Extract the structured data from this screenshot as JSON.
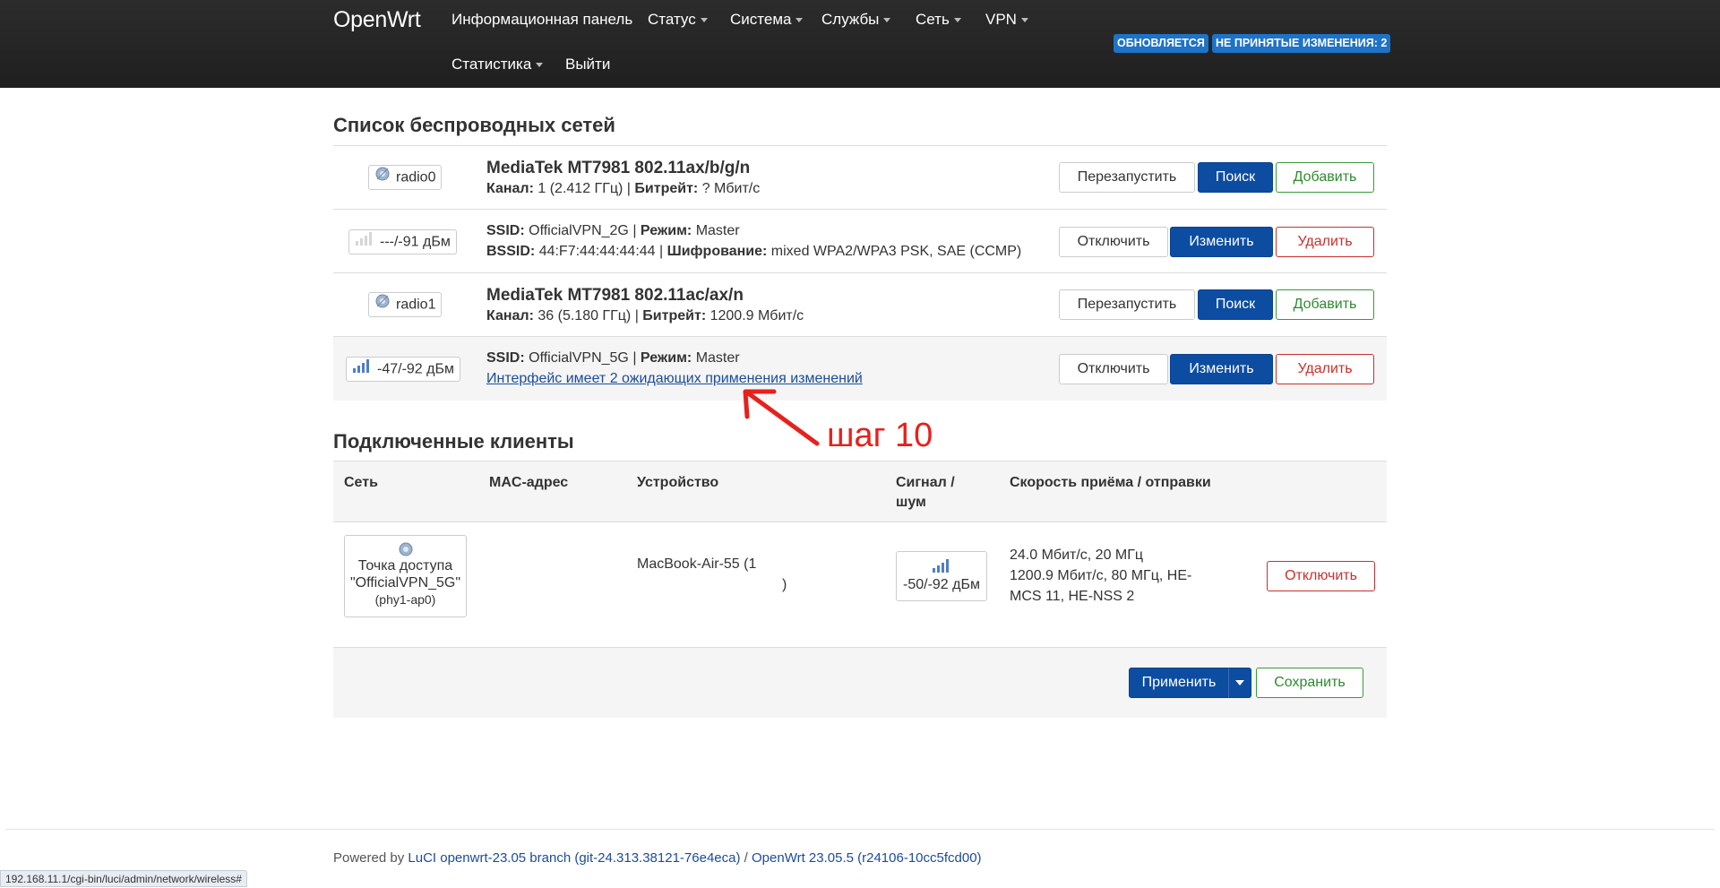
{
  "header": {
    "brand": "OpenWrt",
    "nav": [
      {
        "label": "Информационная панель",
        "dropdown": false
      },
      {
        "label": "Статус",
        "dropdown": true
      },
      {
        "label": "Система",
        "dropdown": true
      },
      {
        "label": "Службы",
        "dropdown": true
      },
      {
        "label": "Сеть",
        "dropdown": true
      },
      {
        "label": "VPN",
        "dropdown": true
      },
      {
        "label": "Статистика",
        "dropdown": true
      },
      {
        "label": "Выйти",
        "dropdown": false
      }
    ],
    "badge_updating": "ОБНОВЛЯЕТСЯ",
    "badge_unsaved": "НЕ ПРИНЯТЫЕ ИЗМЕНЕНИЯ: 2"
  },
  "wireless": {
    "heading": "Список беспроводных сетей",
    "radio0": {
      "device": "radio0",
      "title": "MediaTek MT7981 802.11ax/b/g/n",
      "channel_label": "Канал:",
      "channel_value": "1 (2.412 ГГц)",
      "bitrate_label": "Битрейт:",
      "bitrate_value": "? Мбит/с",
      "restart": "Перезапустить",
      "scan": "Поиск",
      "add": "Добавить"
    },
    "net0": {
      "signal": "---/-91 дБм",
      "ssid_label": "SSID:",
      "ssid_value": "OfficialVPN_2G",
      "mode_label": "Режим:",
      "mode_value": "Master",
      "bssid_label": "BSSID:",
      "bssid_value": "44:F7:44:44:44:44",
      "enc_label": "Шифрование:",
      "enc_value": "mixed WPA2/WPA3 PSK, SAE (CCMP)",
      "disable": "Отключить",
      "edit": "Изменить",
      "delete": "Удалить"
    },
    "radio1": {
      "device": "radio1",
      "title": "MediaTek MT7981 802.11ac/ax/n",
      "channel_label": "Канал:",
      "channel_value": "36 (5.180 ГГц)",
      "bitrate_label": "Битрейт:",
      "bitrate_value": "1200.9 Мбит/с",
      "restart": "Перезапустить",
      "scan": "Поиск",
      "add": "Добавить"
    },
    "net1": {
      "signal": "-47/-92 дБм",
      "ssid_label": "SSID:",
      "ssid_value": "OfficialVPN_5G",
      "mode_label": "Режим:",
      "mode_value": "Master",
      "pending_link": "Интерфейс имеет 2 ожидающих применения изменений",
      "disable": "Отключить",
      "edit": "Изменить",
      "delete": "Удалить"
    }
  },
  "annotation": "шаг 10",
  "clients": {
    "heading": "Подключенные клиенты",
    "columns": [
      "Сеть",
      "MAC-адрес",
      "Устройство",
      "Сигнал /",
      "шум",
      "Скорость приёма / отправки"
    ],
    "row": {
      "network_line1": "Точка доступа",
      "network_line2": "\"OfficialVPN_5G\"",
      "network_line3": "(phy1-ap0)",
      "device": "MacBook-Air-55 (1",
      "device_tail": ")",
      "signal": "-50/-92 дБм",
      "rate_line1": "24.0 Мбит/с, 20 МГц",
      "rate_line2": "1200.9 Мбит/с, 80 МГц, HE-",
      "rate_line3": "MCS 11, HE-NSS 2",
      "disconnect": "Отключить"
    }
  },
  "actions": {
    "apply": "Применить",
    "save": "Сохранить"
  },
  "footer": {
    "powered": "Powered by ",
    "luci": "LuCI openwrt-23.05 branch (git-24.313.38121-76e4eca)",
    "sep": " / ",
    "openwrt": "OpenWrt 23.05.5 (r24106-10cc5fcd00)"
  },
  "status_url": "192.168.11.1/cgi-bin/luci/admin/network/wireless#",
  "colors": {
    "header_bg": "#252525",
    "primary": "#0c4da2",
    "badge": "#1e73c7",
    "annotation": "#e6211c"
  }
}
